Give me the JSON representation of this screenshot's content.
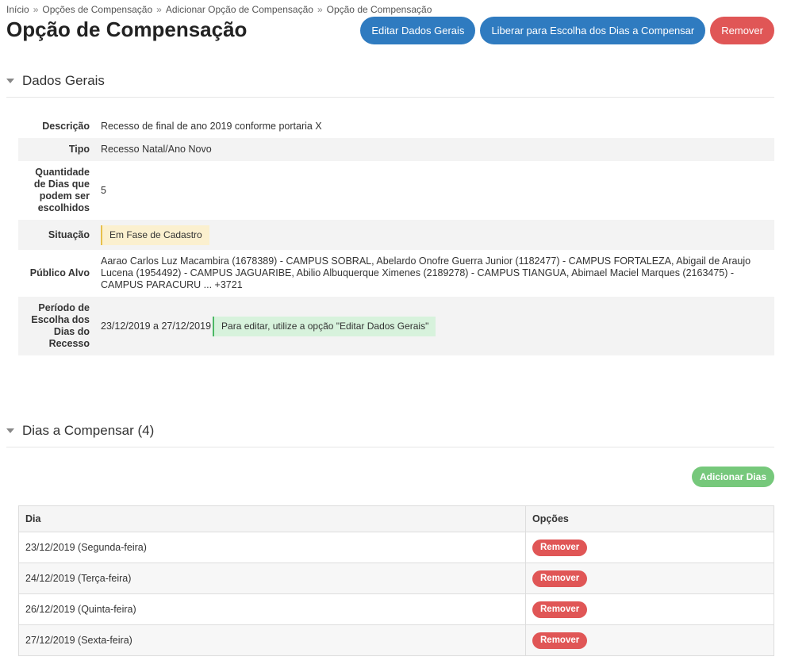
{
  "breadcrumb": [
    "Início",
    "Opções de Compensação",
    "Adicionar Opção de Compensação",
    "Opção de Compensação"
  ],
  "breadcrumb_separator": "»",
  "page_title": "Opção de Compensação",
  "actions": {
    "edit": "Editar Dados Gerais",
    "release": "Liberar para Escolha dos Dias a Compensar",
    "remove": "Remover"
  },
  "general": {
    "title": "Dados Gerais",
    "descricao_label": "Descrição",
    "descricao": "Recesso de final de ano 2019 conforme portaria X",
    "tipo_label": "Tipo",
    "tipo": "Recesso Natal/Ano Novo",
    "quantidade_label": "Quantidade de Dias que podem ser escolhidos",
    "quantidade": "5",
    "situacao_label": "Situação",
    "situacao": "Em Fase de Cadastro",
    "publico_label": "Público Alvo",
    "publico": "Aarao Carlos Luz Macambira (1678389) - CAMPUS SOBRAL, Abelardo Onofre Guerra Junior (1182477) - CAMPUS FORTALEZA, Abigail de Araujo Lucena (1954492) - CAMPUS JAGUARIBE, Abilio Albuquerque Ximenes (2189278) - CAMPUS TIANGUA, Abimael Maciel Marques (2163475) - CAMPUS PARACURU ... +3721",
    "periodo_label": "Período de Escolha dos Dias do Recesso",
    "periodo": "23/12/2019 a 27/12/2019",
    "periodo_hint": "Para editar, utilize a opção \"Editar Dados Gerais\""
  },
  "days": {
    "title": "Dias a Compensar (4)",
    "add_button": "Adicionar Dias",
    "columns": [
      "Dia",
      "Opções"
    ],
    "remove_label": "Remover",
    "rows": [
      "23/12/2019 (Segunda-feira)",
      "24/12/2019 (Terça-feira)",
      "26/12/2019 (Quinta-feira)",
      "27/12/2019 (Sexta-feira)"
    ]
  },
  "colors": {
    "primary": "#2f7bc0",
    "danger": "#e05656",
    "success": "#76c87b",
    "warning_bg": "#fbf0cf",
    "success_bg": "#d7f2dc"
  }
}
